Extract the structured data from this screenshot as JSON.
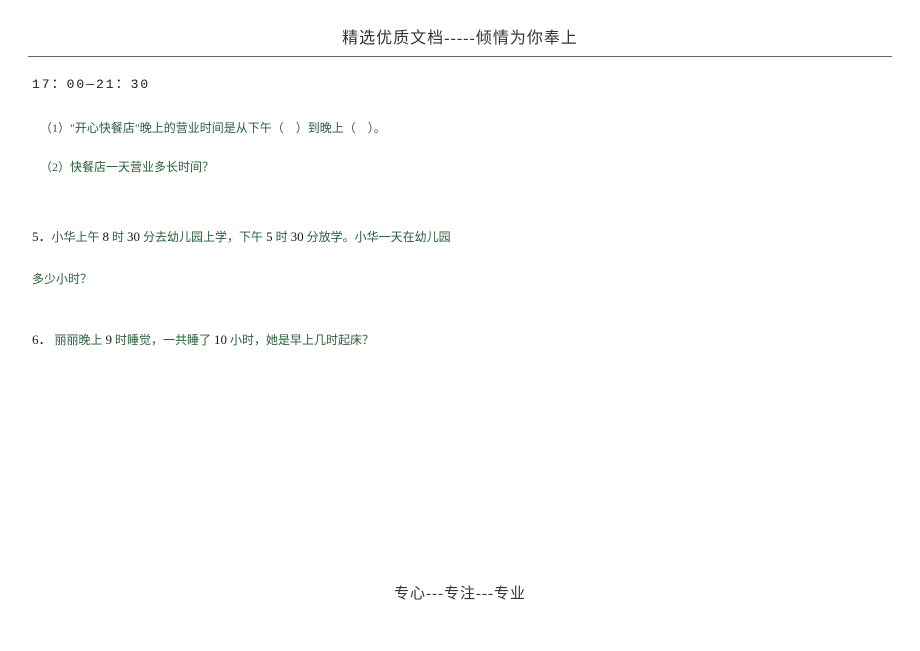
{
  "header": {
    "title": "精选优质文档-----倾情为你奉上"
  },
  "content": {
    "time_range": "17：00—21：30",
    "sub_q1": "（1）\"开心快餐店\"晚上的营业时间是从下午（　）到晚上（　）。",
    "sub_q2": "（2）快餐店一天营业多长时间？",
    "q5_prefix": "5．",
    "q5_part1": "小华上午 ",
    "q5_num1": "8",
    "q5_part2": " 时 ",
    "q5_num2": "30",
    "q5_part3": " 分去幼儿园上学，下午 ",
    "q5_num3": "5",
    "q5_part4": " 时 ",
    "q5_num4": "30",
    "q5_part5": " 分放学。小华一天在幼儿园",
    "q5_line2": "多少小时？",
    "q6_prefix": "6．",
    "q6_part1": " 丽丽晚上 ",
    "q6_num1": "9",
    "q6_part2": " 时睡觉，一共睡了 ",
    "q6_num2": "10",
    "q6_part3": " 小时，她是早上几时起床？"
  },
  "footer": {
    "text": "专心---专注---专业"
  }
}
